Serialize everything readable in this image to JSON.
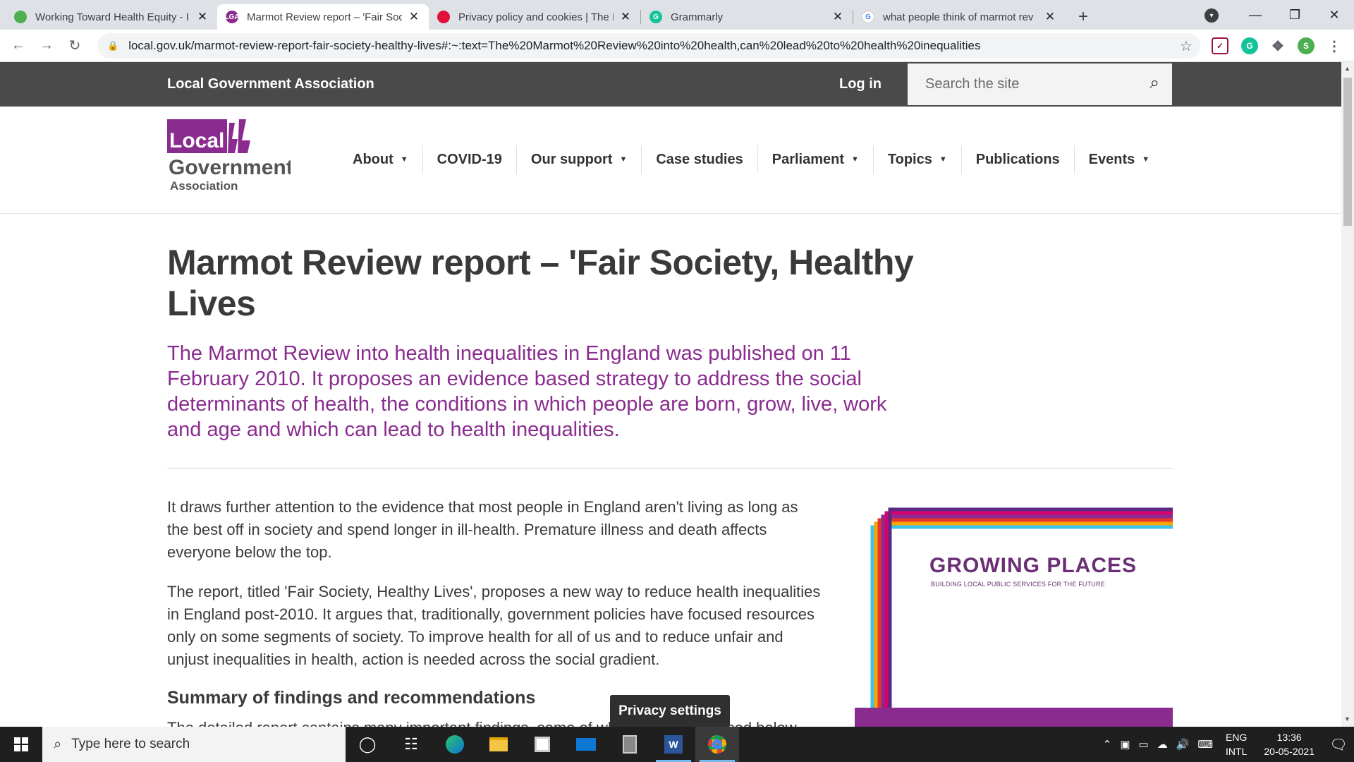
{
  "browser": {
    "tabs": [
      {
        "title": "Working Toward Health Equity - I",
        "favicon_color": "#4caf50",
        "favicon_text": ""
      },
      {
        "title": "Marmot Review report – 'Fair Soc",
        "favicon_color": "#8a2b8f",
        "favicon_text": "LGA",
        "active": true
      },
      {
        "title": "Privacy policy and cookies | The I",
        "favicon_color": "#e0123a",
        "favicon_text": ""
      },
      {
        "title": "Grammarly",
        "favicon_color": "#15c39a",
        "favicon_text": "G"
      },
      {
        "title": "what people think of marmot rev",
        "favicon_color": "#ffffff",
        "favicon_text": "G"
      }
    ],
    "url": "local.gov.uk/marmot-review-report-fair-society-healthy-lives#:~:text=The%20Marmot%20Review%20into%20health,can%20lead%20to%20health%20inequalities",
    "profile_initial": "S"
  },
  "site": {
    "brand": "Local Government Association",
    "login": "Log in",
    "search_placeholder": "Search the site",
    "logo": {
      "line1": "Local",
      "line2": "Government",
      "line3": "Association"
    },
    "nav": [
      {
        "label": "About",
        "dropdown": true
      },
      {
        "label": "COVID-19",
        "dropdown": false
      },
      {
        "label": "Our support",
        "dropdown": true
      },
      {
        "label": "Case studies",
        "dropdown": false
      },
      {
        "label": "Parliament",
        "dropdown": true
      },
      {
        "label": "Topics",
        "dropdown": true
      },
      {
        "label": "Publications",
        "dropdown": false
      },
      {
        "label": "Events",
        "dropdown": true
      }
    ]
  },
  "article": {
    "title": "Marmot Review report – 'Fair Society, Healthy Lives",
    "lead": "The Marmot Review into health inequalities in England was published on 11 February 2010. It proposes an evidence based strategy to address the social determinants of health, the conditions in which people are born, grow, live, work and age and which can lead to health inequalities.",
    "para1": "It draws further attention to the evidence that most people in England aren't living as long as the best off in society and spend longer in ill-health. Premature illness and death affects everyone below the top.",
    "para2": "The report, titled 'Fair Society, Healthy Lives', proposes a new way to reduce health inequalities in England post-2010. It argues that, traditionally, government policies have focused resources only on some segments of society. To improve health for all of us and to reduce unfair and unjust inequalities in health, action is needed across the social gradient.",
    "subheading": "Summary of findings and recommendations",
    "cut_line": "The detailed report contains many important findings, some of which are summarised below"
  },
  "promo": {
    "title": "GROWING PLACES",
    "subtitle": "BUILDING LOCAL PUBLIC SERVICES FOR THE FUTURE"
  },
  "privacy_button": "Privacy settings",
  "taskbar": {
    "search_placeholder": "Type here to search",
    "lang_line1": "ENG",
    "lang_line2": "INTL",
    "time": "13:36",
    "date": "20-05-2021"
  }
}
